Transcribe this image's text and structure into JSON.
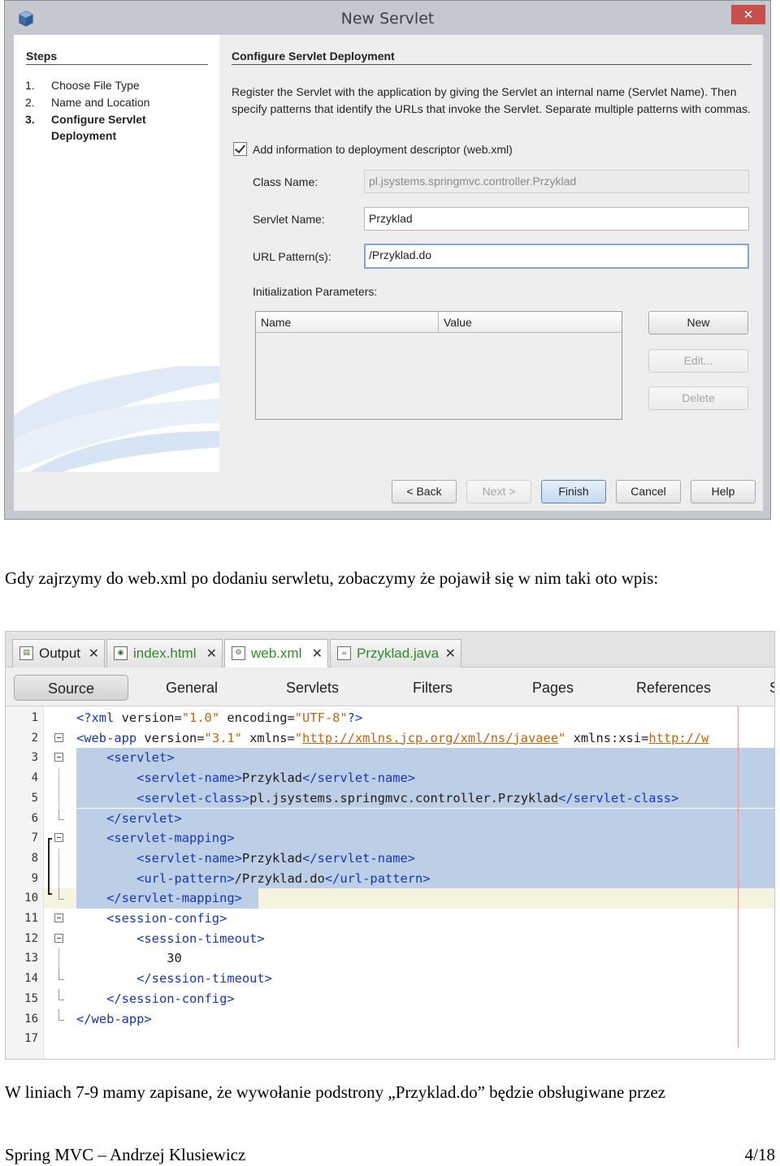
{
  "dialog": {
    "title": "New Servlet",
    "close_label": "✕",
    "steps_title": "Steps",
    "steps": [
      {
        "num": "1.",
        "label": "Choose File Type"
      },
      {
        "num": "2.",
        "label": "Name and Location"
      },
      {
        "num": "3.",
        "label": "Configure Servlet Deployment"
      }
    ],
    "section_title": "Configure Servlet Deployment",
    "description": "Register the Servlet with the application by giving the Servlet an internal name (Servlet Name). Then specify patterns that identify the URLs that invoke the Servlet. Separate multiple patterns with commas.",
    "add_info_label": "Add information to deployment descriptor (web.xml)",
    "add_info_checked": true,
    "class_name_label": "Class Name:",
    "class_name_value": "pl.jsystems.springmvc.controller.Przyklad",
    "servlet_name_label": "Servlet Name:",
    "servlet_name_value": "Przyklad",
    "url_pattern_label": "URL Pattern(s):",
    "url_pattern_value": "/Przyklad.do",
    "init_params_label": "Initialization Parameters:",
    "table_headers": [
      "Name",
      "Value"
    ],
    "side_buttons": {
      "new": "New",
      "edit": "Edit...",
      "delete": "Delete"
    },
    "buttons": {
      "back": "< Back",
      "next": "Next >",
      "finish": "Finish",
      "cancel": "Cancel",
      "help": "Help"
    }
  },
  "text1": "Gdy zajrzymy do web.xml po dodaniu serwletu, zobaczymy że pojawił się w nim taki oto wpis:",
  "editor": {
    "tabs": [
      {
        "label": "Output",
        "icon": "output-icon"
      },
      {
        "label": "index.html",
        "icon": "html-file-icon"
      },
      {
        "label": "web.xml",
        "icon": "xml-file-icon"
      },
      {
        "label": "Przyklad.java",
        "icon": "java-file-icon"
      }
    ],
    "tab_close": "✕",
    "view_tabs": [
      "Source",
      "General",
      "Servlets",
      "Filters",
      "Pages",
      "References",
      "S"
    ],
    "lines": [
      {
        "n": "1",
        "text": "<?xml version=\"1.0\" encoding=\"UTF-8\"?>"
      },
      {
        "n": "2",
        "text": "<web-app version=\"3.1\" xmlns=\"http://xmlns.jcp.org/xml/ns/javaee\" xmlns:xsi=\"http://w"
      },
      {
        "n": "3",
        "text": "    <servlet>"
      },
      {
        "n": "4",
        "text": "        <servlet-name>Przyklad</servlet-name>"
      },
      {
        "n": "5",
        "text": "        <servlet-class>pl.jsystems.springmvc.controller.Przyklad</servlet-class>"
      },
      {
        "n": "6",
        "text": "    </servlet>"
      },
      {
        "n": "7",
        "text": "    <servlet-mapping>"
      },
      {
        "n": "8",
        "text": "        <servlet-name>Przyklad</servlet-name>"
      },
      {
        "n": "9",
        "text": "        <url-pattern>/Przyklad.do</url-pattern>"
      },
      {
        "n": "10",
        "text": "    </servlet-mapping>"
      },
      {
        "n": "11",
        "text": "    <session-config>"
      },
      {
        "n": "12",
        "text": "        <session-timeout>"
      },
      {
        "n": "13",
        "text": "            30"
      },
      {
        "n": "14",
        "text": "        </session-timeout>"
      },
      {
        "n": "15",
        "text": "    </session-config>"
      },
      {
        "n": "16",
        "text": "</web-app>"
      },
      {
        "n": "17",
        "text": ""
      }
    ]
  },
  "text2": "W liniach 7-9 mamy zapisane, że wywołanie podstrony „Przyklad.do” będzie obsługiwane przez",
  "footer": {
    "left": "Spring MVC – Andrzej Klusiewicz",
    "right": "4/18"
  }
}
